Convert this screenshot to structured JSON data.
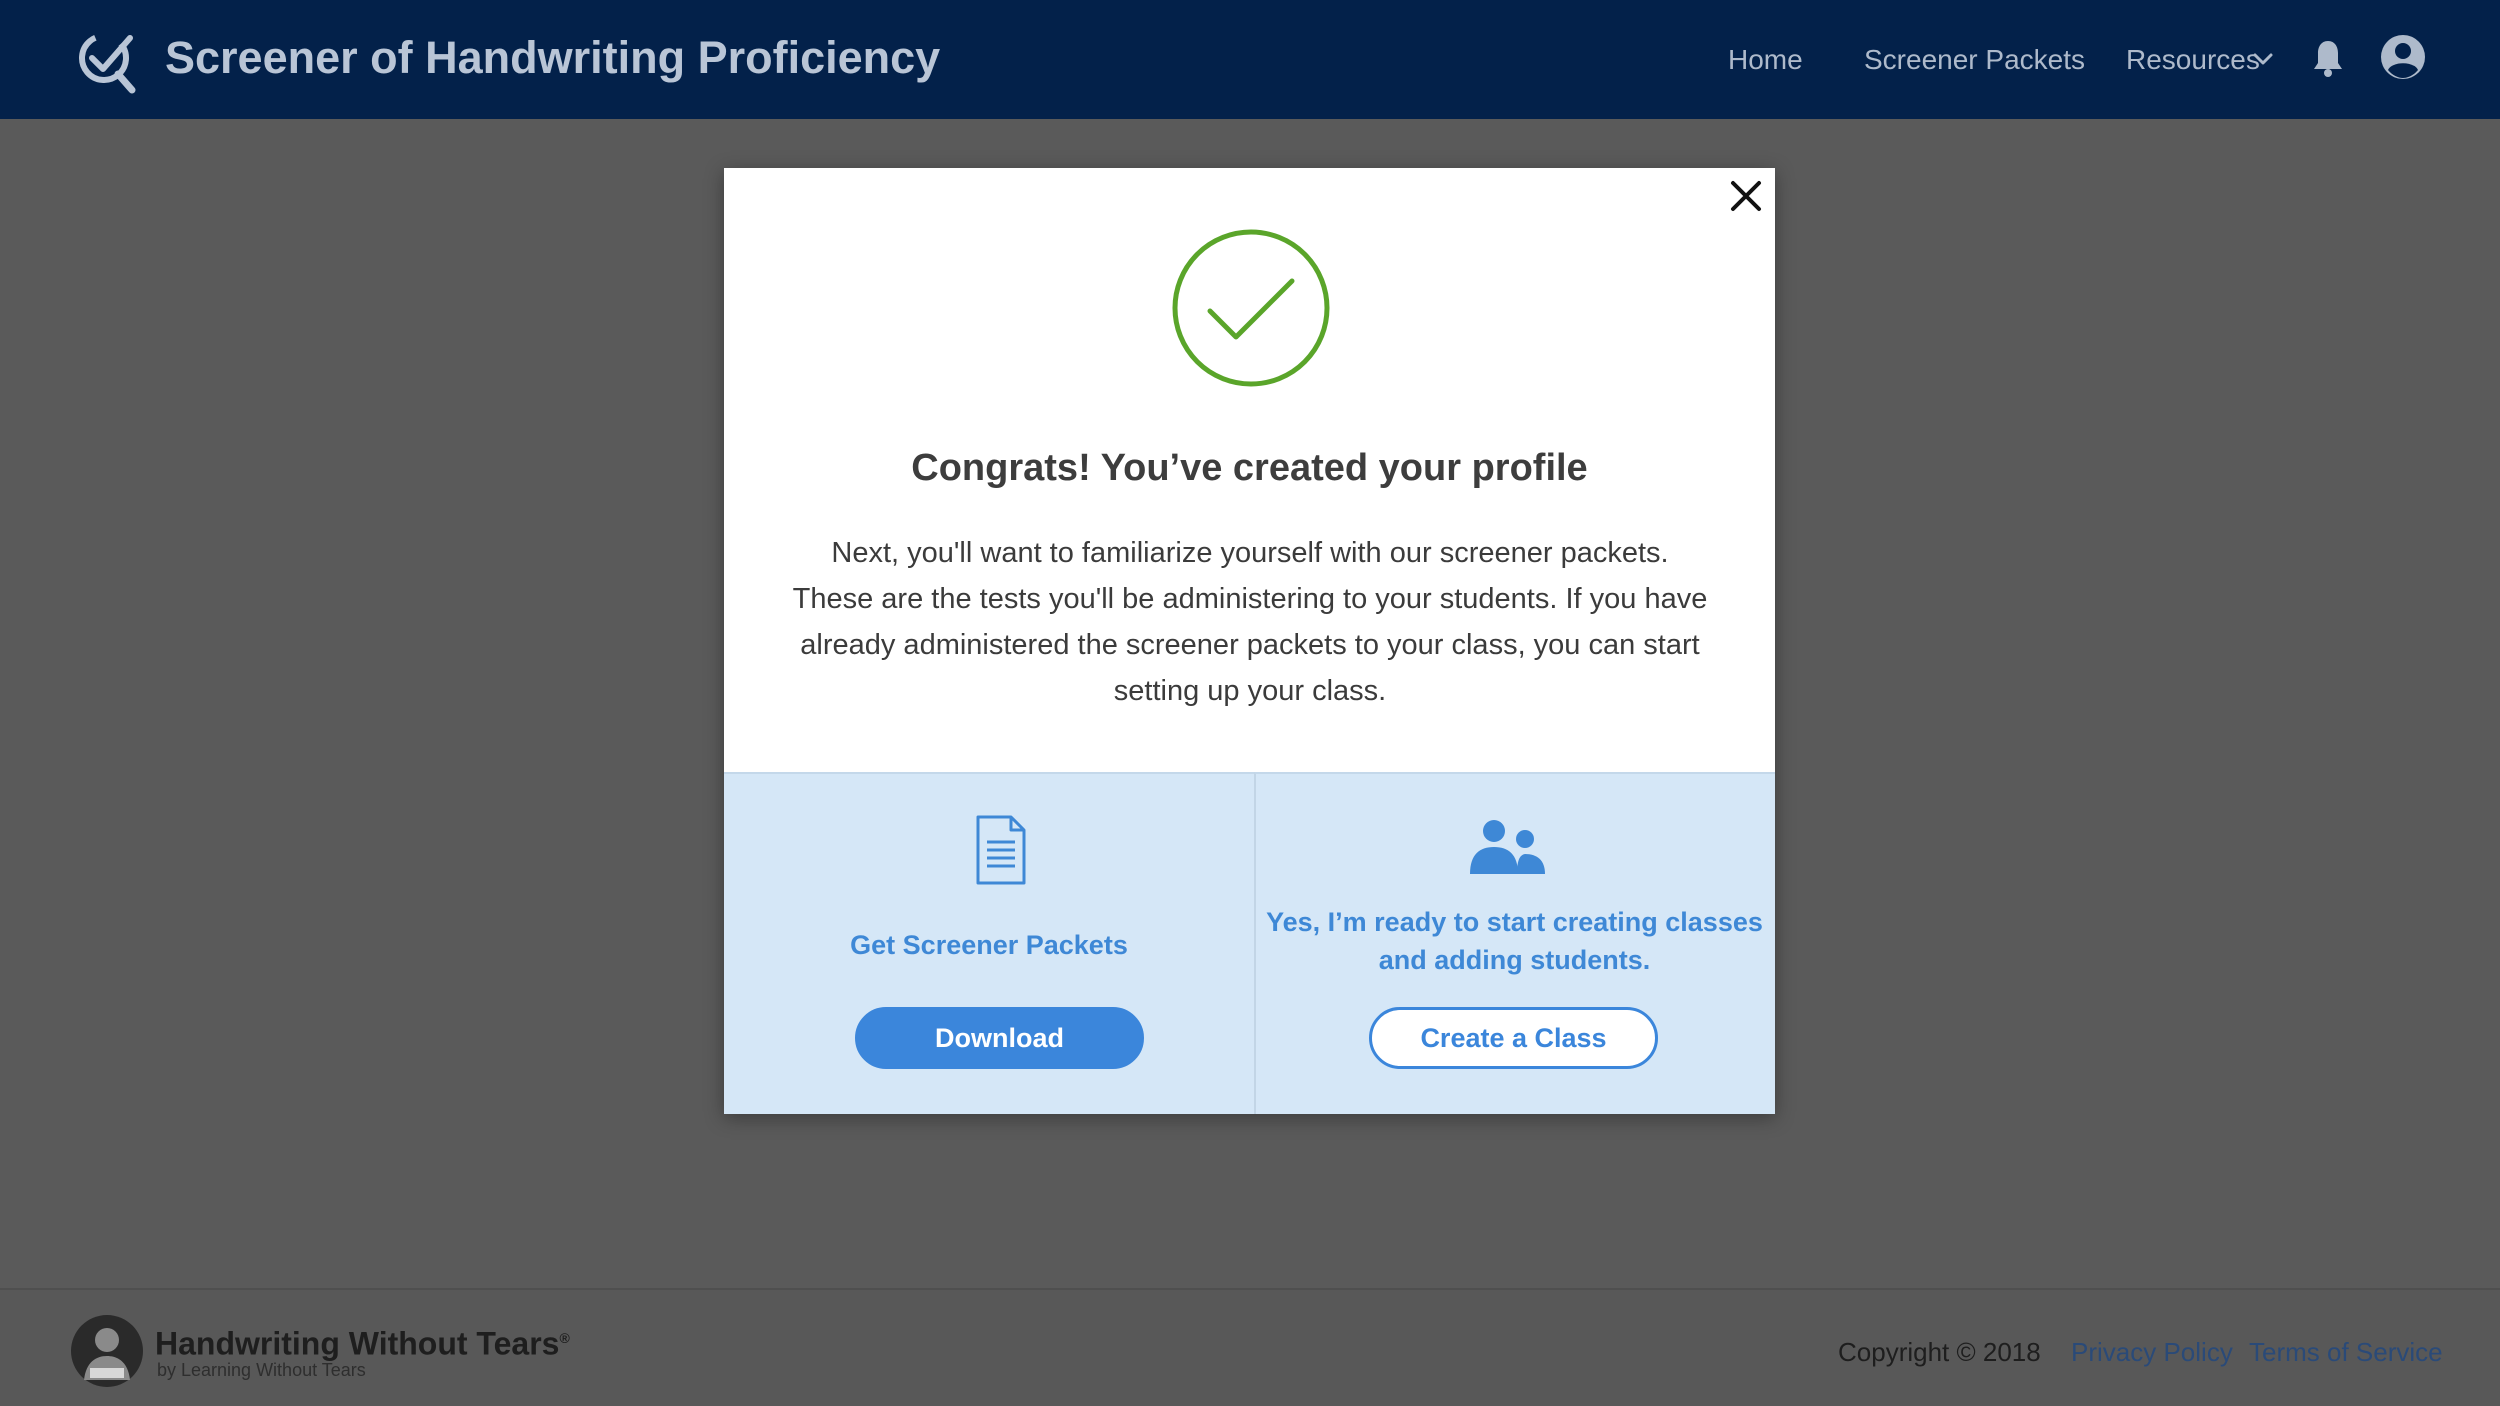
{
  "header": {
    "title": "Screener of Handwriting Proficiency",
    "nav": {
      "home": "Home",
      "packets": "Screener Packets",
      "resources": "Resources"
    },
    "icons": [
      "check-search-logo-icon",
      "chevron-down-icon",
      "bell-icon",
      "user-avatar-icon"
    ],
    "background": "#03214a"
  },
  "modal": {
    "title": "Congrats! You’ve created your profile",
    "body": "Next, you'll want to familiarize yourself with our screener packets. These are the tests you'll be administering to your students. If you have already administered the screener packets to your class, you can start setting up your class.",
    "options": [
      {
        "label": "Get Screener Packets",
        "button": "Download",
        "icon": "document-icon"
      },
      {
        "label": "Yes, I’m ready to start creating classes and adding students.",
        "button": "Create a Class",
        "icon": "people-icon"
      }
    ],
    "accent": "#3b86db",
    "success_color": "#5aa52a"
  },
  "footer": {
    "brand": "Handwriting Without Tears",
    "brand_mark": "®",
    "subtitle": "by Learning Without Tears",
    "copyright": "Copyright © 2018",
    "privacy": "Privacy Policy",
    "terms": "Terms of Service"
  }
}
